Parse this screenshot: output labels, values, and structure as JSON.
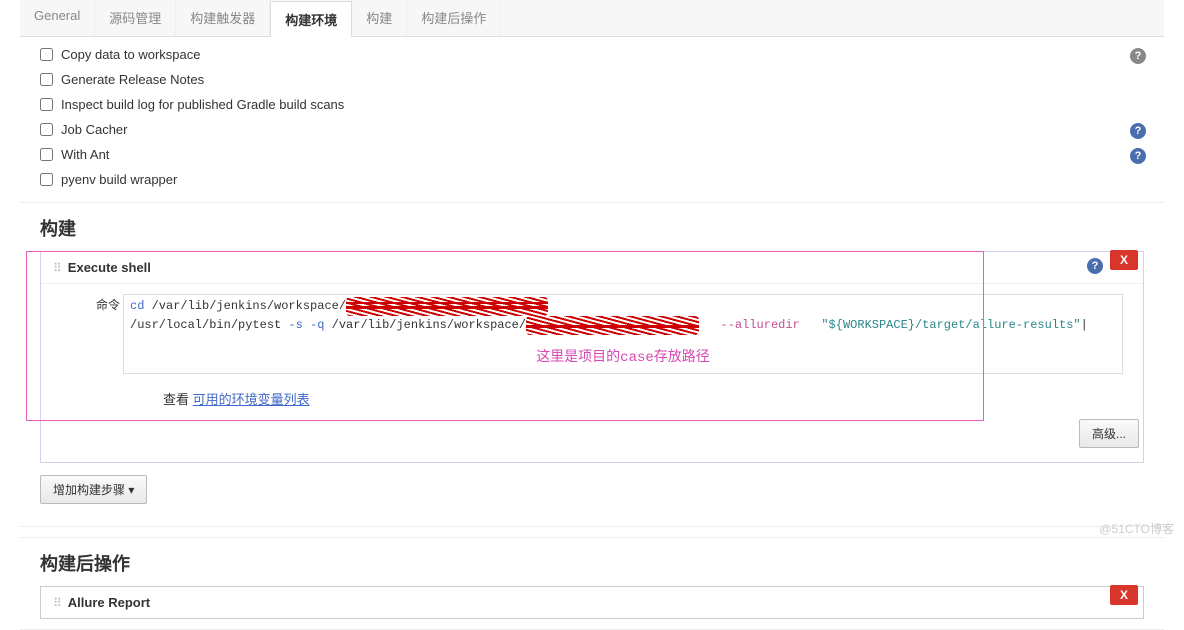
{
  "tabs": [
    {
      "label": "General"
    },
    {
      "label": "源码管理"
    },
    {
      "label": "构建触发器"
    },
    {
      "label": "构建环境",
      "active": true
    },
    {
      "label": "构建"
    },
    {
      "label": "构建后操作"
    }
  ],
  "env_options": [
    {
      "label": "Copy data to workspace",
      "help": true,
      "blue": false
    },
    {
      "label": "Generate Release Notes",
      "help": false
    },
    {
      "label": "Inspect build log for published Gradle build scans",
      "help": false
    },
    {
      "label": "Job Cacher",
      "help": true,
      "blue": true
    },
    {
      "label": "With Ant",
      "help": true,
      "blue": true
    },
    {
      "label": "pyenv build wrapper",
      "help": false
    }
  ],
  "sections": {
    "build": "构建",
    "postbuild": "构建后操作"
  },
  "execute_shell": {
    "title": "Execute shell",
    "cmd_label": "命令",
    "line1_a": "cd",
    "line1_b": "/var/lib/jenkins/workspace/",
    "line1_redact": "xxxxxxxxxxxxxxxxxxxxxxxxxxxx",
    "line2_a": "/usr/local/bin/pytest",
    "line2_b": "-s -q",
    "line2_c": "/var/lib/jenkins/workspace/",
    "line2_redact": "xxxxxxxxxxxxxxxxxxxxxxxx",
    "line2_d": "--alluredir",
    "line2_e": "\"${WORKSPACE}/target/allure-results\"",
    "annotation": "这里是项目的case存放路径",
    "view_label": "查看",
    "env_link": "可用的环境变量列表",
    "advanced_btn": "高级..."
  },
  "add_step_btn": "增加构建步骤",
  "allure": {
    "title": "Allure Report"
  },
  "close_label": "X",
  "watermark": "@51CTO博客"
}
